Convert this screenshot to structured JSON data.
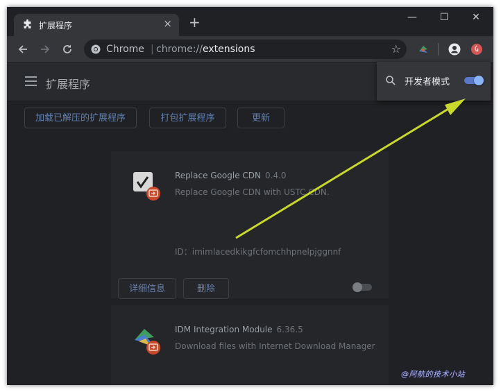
{
  "tab": {
    "title": "扩展程序",
    "close": "×"
  },
  "new_tab": "+",
  "window_controls": {
    "minimize": "—",
    "maximize": "☐",
    "close": "✕"
  },
  "omnibox": {
    "site_label": "Chrome",
    "separator": "|",
    "url_scheme": "chrome://",
    "url_host": "extensions",
    "star": "☆"
  },
  "header": {
    "title": "扩展程序"
  },
  "dev_mode": {
    "label": "开发者模式",
    "enabled": true
  },
  "actions": {
    "load_unpacked": "加载已解压的扩展程序",
    "pack": "打包扩展程序",
    "update": "更新"
  },
  "extensions": [
    {
      "name": "Replace Google CDN",
      "version": "0.4.0",
      "description": "Replace Google CDN with USTC CDN.",
      "id": "ID：imimlacedkikgfcfomchhpnelpjggnnf",
      "details_label": "详细信息",
      "remove_label": "删除",
      "enabled": false
    },
    {
      "name": "IDM Integration Module",
      "version": "6.36.5",
      "description": "Download files with Internet Download Manager"
    }
  ],
  "watermark": "@阿航的技术小站",
  "colors": {
    "accent": "#8ab4f8",
    "arrow": "#c8d82c",
    "background": "#202124"
  }
}
